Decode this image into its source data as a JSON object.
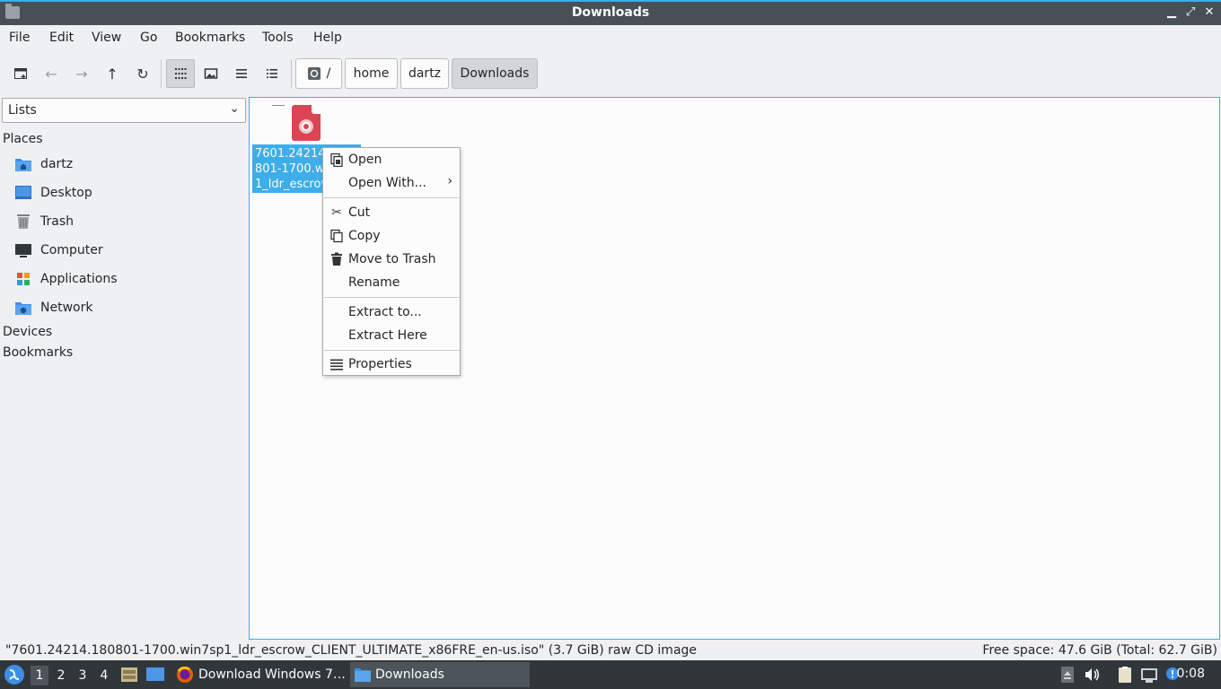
{
  "window": {
    "title": "Downloads"
  },
  "menubar": [
    "File",
    "Edit",
    "View",
    "Go",
    "Bookmarks",
    "Tools",
    "Help"
  ],
  "breadcrumb": {
    "root": "/",
    "parts": [
      "home",
      "dartz",
      "Downloads"
    ]
  },
  "sidebar": {
    "combo": "Lists",
    "places_header": "Places",
    "places": [
      {
        "label": "dartz",
        "icon": "home-folder-icon"
      },
      {
        "label": "Desktop",
        "icon": "desktop-icon"
      },
      {
        "label": "Trash",
        "icon": "trash-icon"
      },
      {
        "label": "Computer",
        "icon": "computer-icon"
      },
      {
        "label": "Applications",
        "icon": "applications-icon"
      },
      {
        "label": "Network",
        "icon": "network-folder-icon"
      }
    ],
    "devices_header": "Devices",
    "bookmarks_header": "Bookmarks"
  },
  "file": {
    "label_lines": [
      "7601.24214.180",
      "801-1700.win7sp",
      "1_ldr_escrow_C"
    ],
    "icon": "disc-image-icon"
  },
  "context_menu": {
    "open": "Open",
    "open_with": "Open With...",
    "cut": "Cut",
    "copy": "Copy",
    "trash": "Move to Trash",
    "rename": "Rename",
    "extract_to": "Extract to...",
    "extract_here": "Extract Here",
    "properties": "Properties"
  },
  "status": {
    "left": "\"7601.24214.180801-1700.win7sp1_ldr_escrow_CLIENT_ULTIMATE_x86FRE_en-us.iso\" (3.7 GiB) raw CD image",
    "right": "Free space: 47.6 GiB (Total: 62.7 GiB)"
  },
  "taskbar": {
    "workspaces": [
      "1",
      "2",
      "3",
      "4"
    ],
    "tasks": [
      "Download Windows 7…",
      "Downloads"
    ],
    "clock": "0:08"
  },
  "colors": {
    "accent": "#3daee9",
    "titlebar": "#475057",
    "taskbar": "#31363b",
    "iso_red": "#da4453"
  }
}
